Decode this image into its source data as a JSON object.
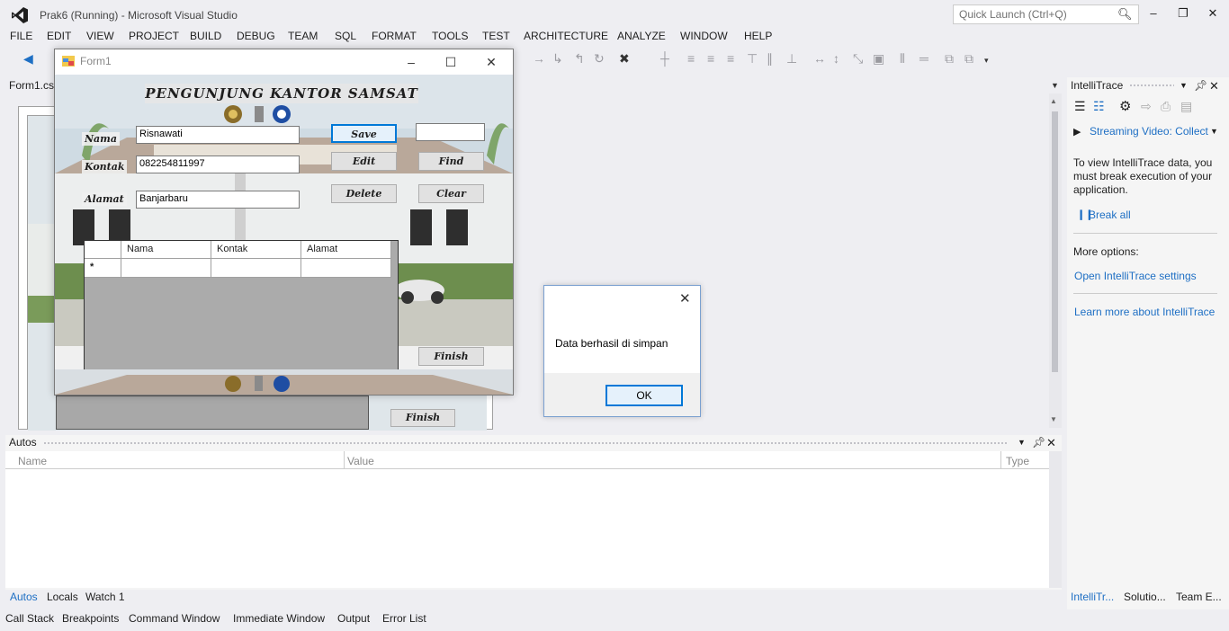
{
  "window": {
    "title": "Prak6 (Running) - Microsoft Visual Studio",
    "quick_launch_placeholder": "Quick Launch (Ctrl+Q)"
  },
  "menu": [
    "FILE",
    "EDIT",
    "VIEW",
    "PROJECT",
    "BUILD",
    "DEBUG",
    "TEAM",
    "SQL",
    "FORMAT",
    "TOOLS",
    "TEST",
    "ARCHITECTURE",
    "ANALYZE",
    "WINDOW",
    "HELP"
  ],
  "document_tab": {
    "label": "Form1.cs"
  },
  "form1": {
    "title": "Form1",
    "heading": "PENGUNJUNG KANTOR SAMSAT",
    "fields": {
      "nama_label": "Nama",
      "nama_value": "Risnawati",
      "kontak_label": "Kontak",
      "kontak_value": "082254811997",
      "alamat_label": "Alamat",
      "alamat_value": "Banjarbaru",
      "find_value": ""
    },
    "buttons": {
      "save": "Save",
      "edit": "Edit",
      "delete": "Delete",
      "find": "Find",
      "clear": "Clear",
      "finish": "Finish"
    },
    "grid": {
      "columns": [
        "Nama",
        "Kontak",
        "Alamat"
      ],
      "new_row_marker": "*"
    }
  },
  "designer": {
    "finish_label": "Finish"
  },
  "message_box": {
    "text": "Data berhasil di simpan",
    "ok_label": "OK"
  },
  "autos": {
    "title": "Autos",
    "columns": {
      "name": "Name",
      "value": "Value",
      "type": "Type"
    },
    "tabs": [
      "Autos",
      "Locals",
      "Watch 1"
    ],
    "bottom_tabs": [
      "Call Stack",
      "Breakpoints",
      "Command Window",
      "Immediate Window",
      "Output",
      "Error List"
    ]
  },
  "intellitrace": {
    "title": "IntelliTrace",
    "streaming": "Streaming Video: Collect",
    "info": "To view IntelliTrace data, you must break execution of your application.",
    "break_all": "Break all",
    "more_options": "More options:",
    "open_settings": "Open IntelliTrace settings",
    "learn_more": "Learn more about IntelliTrace",
    "tabs": [
      "IntelliTr...",
      "Solutio...",
      "Team E..."
    ]
  },
  "colors": {
    "accent": "#007acc",
    "link": "#1e6fc4",
    "chrome": "#eeeef2"
  }
}
